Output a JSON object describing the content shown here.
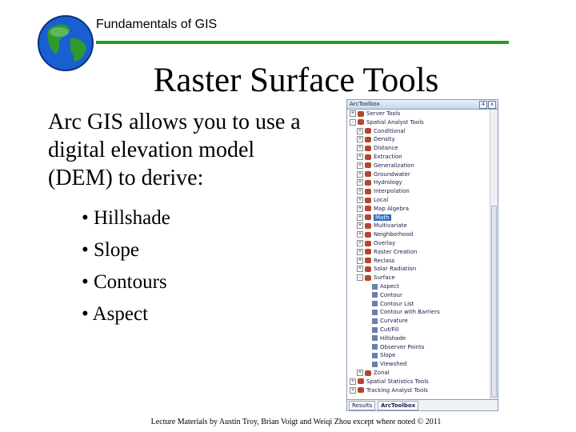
{
  "header": {
    "course": "Fundamentals of GIS"
  },
  "slide": {
    "title": "Raster Surface Tools",
    "intro": "Arc GIS allows you to use a digital elevation model (DEM) to derive:",
    "bullets": [
      "• Hillshade",
      "• Slope",
      "• Contours",
      "• Aspect"
    ],
    "footer": "Lecture Materials by Austin Troy, Brian Voigt and Weiqi Zhou except where noted © 2011"
  },
  "toolbox": {
    "title": "ArcToolbox",
    "pin": "4",
    "close": "x",
    "items": [
      {
        "label": "Server Tools",
        "level": 0,
        "expander": "+",
        "kind": "box"
      },
      {
        "label": "Spatial Analyst Tools",
        "level": 0,
        "expander": "-",
        "kind": "box"
      },
      {
        "label": "Conditional",
        "level": 1,
        "expander": "+",
        "kind": "box"
      },
      {
        "label": "Density",
        "level": 1,
        "expander": "+",
        "kind": "box"
      },
      {
        "label": "Distance",
        "level": 1,
        "expander": "+",
        "kind": "box"
      },
      {
        "label": "Extraction",
        "level": 1,
        "expander": "+",
        "kind": "box"
      },
      {
        "label": "Generalization",
        "level": 1,
        "expander": "+",
        "kind": "box"
      },
      {
        "label": "Groundwater",
        "level": 1,
        "expander": "+",
        "kind": "box"
      },
      {
        "label": "Hydrology",
        "level": 1,
        "expander": "+",
        "kind": "box"
      },
      {
        "label": "Interpolation",
        "level": 1,
        "expander": "+",
        "kind": "box"
      },
      {
        "label": "Local",
        "level": 1,
        "expander": "+",
        "kind": "box"
      },
      {
        "label": "Map Algebra",
        "level": 1,
        "expander": "+",
        "kind": "box"
      },
      {
        "label": "Math",
        "level": 1,
        "expander": "+",
        "kind": "box",
        "selected": true
      },
      {
        "label": "Multivariate",
        "level": 1,
        "expander": "+",
        "kind": "box"
      },
      {
        "label": "Neighborhood",
        "level": 1,
        "expander": "+",
        "kind": "box"
      },
      {
        "label": "Overlay",
        "level": 1,
        "expander": "+",
        "kind": "box"
      },
      {
        "label": "Raster Creation",
        "level": 1,
        "expander": "+",
        "kind": "box"
      },
      {
        "label": "Reclass",
        "level": 1,
        "expander": "+",
        "kind": "box"
      },
      {
        "label": "Solar Radiation",
        "level": 1,
        "expander": "+",
        "kind": "box"
      },
      {
        "label": "Surface",
        "level": 1,
        "expander": "-",
        "kind": "box"
      },
      {
        "label": "Aspect",
        "level": 2,
        "expander": "",
        "kind": "tool"
      },
      {
        "label": "Contour",
        "level": 2,
        "expander": "",
        "kind": "tool"
      },
      {
        "label": "Contour List",
        "level": 2,
        "expander": "",
        "kind": "tool"
      },
      {
        "label": "Contour with Barriers",
        "level": 2,
        "expander": "",
        "kind": "tool"
      },
      {
        "label": "Curvature",
        "level": 2,
        "expander": "",
        "kind": "tool"
      },
      {
        "label": "Cut/Fill",
        "level": 2,
        "expander": "",
        "kind": "tool"
      },
      {
        "label": "Hillshade",
        "level": 2,
        "expander": "",
        "kind": "tool"
      },
      {
        "label": "Observer Points",
        "level": 2,
        "expander": "",
        "kind": "tool"
      },
      {
        "label": "Slope",
        "level": 2,
        "expander": "",
        "kind": "tool"
      },
      {
        "label": "Viewshed",
        "level": 2,
        "expander": "",
        "kind": "tool"
      },
      {
        "label": "Zonal",
        "level": 1,
        "expander": "+",
        "kind": "box"
      },
      {
        "label": "Spatial Statistics Tools",
        "level": 0,
        "expander": "+",
        "kind": "box"
      },
      {
        "label": "Tracking Analyst Tools",
        "level": 0,
        "expander": "+",
        "kind": "box"
      }
    ],
    "tabs": [
      "Results",
      "ArcToolbox"
    ]
  }
}
